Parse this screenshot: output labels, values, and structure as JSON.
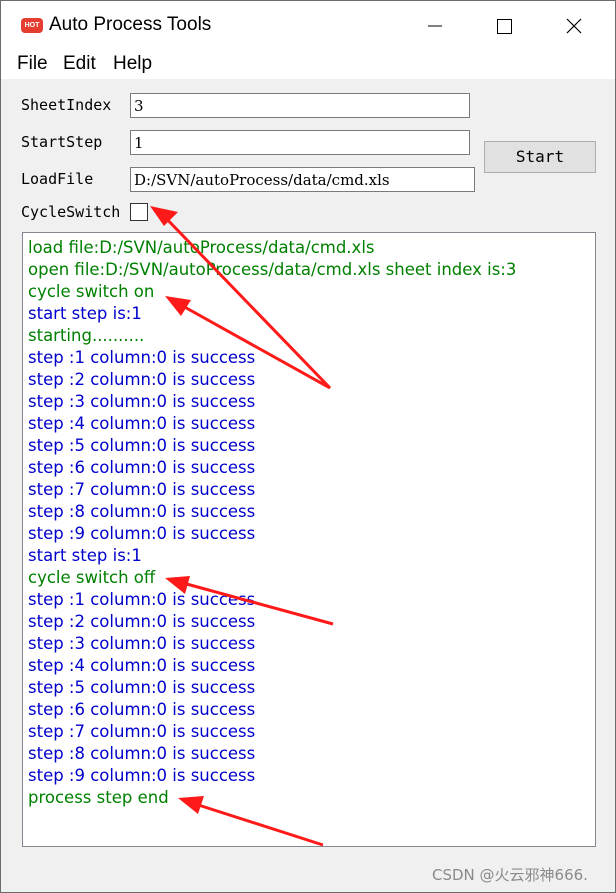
{
  "window": {
    "title": "Auto Process Tools",
    "icon_text": "HOT",
    "controls": [
      "minimize-icon",
      "maximize-icon",
      "close-icon"
    ]
  },
  "menu": [
    "File",
    "Edit",
    "Help"
  ],
  "form": {
    "sheet_index_label": "SheetIndex",
    "sheet_index_value": "3",
    "start_step_label": "StartStep",
    "start_step_value": "1",
    "load_file_label": "LoadFile",
    "load_file_value": "D:/SVN/autoProcess/data/cmd.xls",
    "cycle_switch_label": "CycleSwitch",
    "cycle_switch_checked": false,
    "start_button": "Start"
  },
  "colors": {
    "green": "#008000",
    "blue": "#0000cc",
    "arrow": "#ff1a1a"
  },
  "log": [
    {
      "text": "load file:D:/SVN/autoProcess/data/cmd.xls",
      "color": "green"
    },
    {
      "text": "open file:D:/SVN/autoProcess/data/cmd.xls sheet index is:3",
      "color": "green"
    },
    {
      "text": "cycle switch on",
      "color": "green"
    },
    {
      "text": "start step is:1",
      "color": "blue"
    },
    {
      "text": "starting..........",
      "color": "green"
    },
    {
      "text": "step :1 column:0 is success",
      "color": "blue"
    },
    {
      "text": "step :2 column:0 is success",
      "color": "blue"
    },
    {
      "text": "step :3 column:0 is success",
      "color": "blue"
    },
    {
      "text": "step :4 column:0 is success",
      "color": "blue"
    },
    {
      "text": "step :5 column:0 is success",
      "color": "blue"
    },
    {
      "text": "step :6 column:0 is success",
      "color": "blue"
    },
    {
      "text": "step :7 column:0 is success",
      "color": "blue"
    },
    {
      "text": "step :8 column:0 is success",
      "color": "blue"
    },
    {
      "text": "step :9 column:0 is success",
      "color": "blue"
    },
    {
      "text": "start step is:1",
      "color": "blue"
    },
    {
      "text": "cycle switch off",
      "color": "green"
    },
    {
      "text": "step :1 column:0 is success",
      "color": "blue"
    },
    {
      "text": "step :2 column:0 is success",
      "color": "blue"
    },
    {
      "text": "step :3 column:0 is success",
      "color": "blue"
    },
    {
      "text": "step :4 column:0 is success",
      "color": "blue"
    },
    {
      "text": "step :5 column:0 is success",
      "color": "blue"
    },
    {
      "text": "step :6 column:0 is success",
      "color": "blue"
    },
    {
      "text": "step :7 column:0 is success",
      "color": "blue"
    },
    {
      "text": "step :8 column:0 is success",
      "color": "blue"
    },
    {
      "text": "step :9 column:0 is success",
      "color": "blue"
    },
    {
      "text": "process step end",
      "color": "green"
    }
  ],
  "watermark": "CSDN @火云邪神666."
}
